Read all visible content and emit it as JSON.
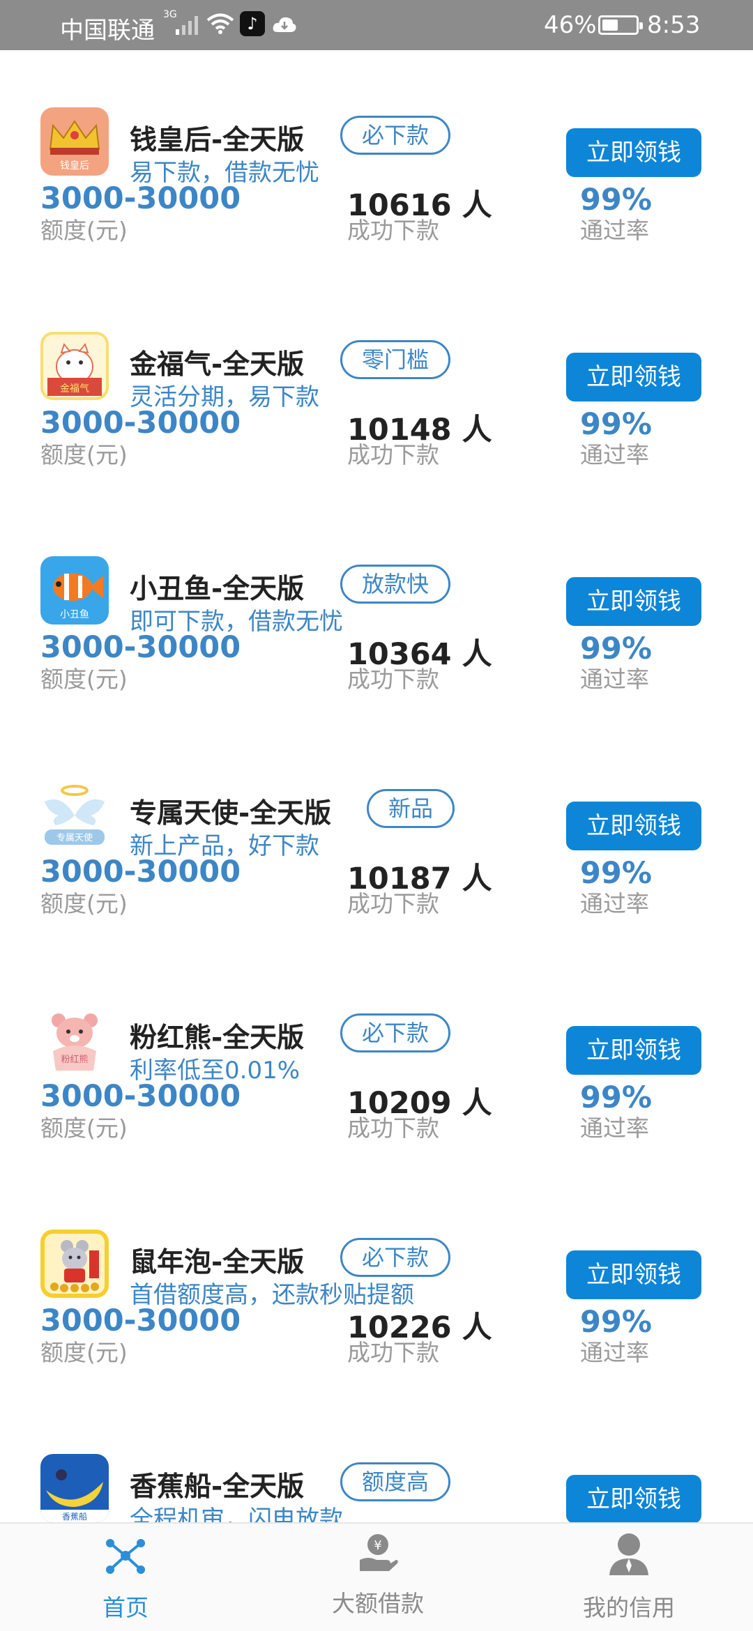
{
  "status_bar": {
    "carrier": "中国联通",
    "network": "3G",
    "tiktok_glyph": "♪",
    "battery": "46%",
    "battery_level": 0.46,
    "time": "8:53"
  },
  "products": [
    {
      "name": "钱皇后-全天版",
      "tag": "必下款",
      "slogan": "易下款，借款无忧",
      "logo_text": "钱皇后",
      "logo_icon": "crown-icon",
      "amount": "3000-30000",
      "amount_label": "额度(元)",
      "count": "10616 人",
      "count_label": "成功下款",
      "rate": "99%",
      "rate_label": "通过率",
      "cta": "立即领钱"
    },
    {
      "name": "金福气-全天版",
      "tag": "零门槛",
      "slogan": "灵活分期，易下款",
      "logo_text": "金福气",
      "logo_icon": "lucky-cat-icon",
      "amount": "3000-30000",
      "amount_label": "额度(元)",
      "count": "10148 人",
      "count_label": "成功下款",
      "rate": "99%",
      "rate_label": "通过率",
      "cta": "立即领钱"
    },
    {
      "name": "小丑鱼-全天版",
      "tag": "放款快",
      "slogan": "即可下款，借款无忧",
      "logo_text": "小丑鱼",
      "logo_icon": "clownfish-icon",
      "amount": "3000-30000",
      "amount_label": "额度(元)",
      "count": "10364 人",
      "count_label": "成功下款",
      "rate": "99%",
      "rate_label": "通过率",
      "cta": "立即领钱"
    },
    {
      "name": "专属天使-全天版",
      "tag": "新品",
      "slogan": "新上产品，好下款",
      "logo_text": "专属天使",
      "logo_icon": "angel-wings-icon",
      "amount": "3000-30000",
      "amount_label": "额度(元)",
      "count": "10187 人",
      "count_label": "成功下款",
      "rate": "99%",
      "rate_label": "通过率",
      "cta": "立即领钱"
    },
    {
      "name": "粉红熊-全天版",
      "tag": "必下款",
      "slogan": "利率低至0.01%",
      "logo_text": "粉红熊",
      "logo_icon": "pink-bear-icon",
      "amount": "3000-30000",
      "amount_label": "额度(元)",
      "count": "10209 人",
      "count_label": "成功下款",
      "rate": "99%",
      "rate_label": "通过率",
      "cta": "立即领钱"
    },
    {
      "name": "鼠年泡-全天版",
      "tag": "必下款",
      "slogan": "首借额度高，还款秒贴提额",
      "logo_text": "",
      "logo_icon": "mouse-coins-icon",
      "amount": "3000-30000",
      "amount_label": "额度(元)",
      "count": "10226 人",
      "count_label": "成功下款",
      "rate": "99%",
      "rate_label": "通过率",
      "cta": "立即领钱"
    },
    {
      "name": "香蕉船-全天版",
      "tag": "额度高",
      "slogan": "全程机审，闪电放款",
      "logo_text": "香蕉船",
      "logo_icon": "banana-boat-icon",
      "amount": "",
      "amount_label": "",
      "count": "",
      "count_label": "",
      "rate": "",
      "rate_label": "",
      "cta": "立即领钱"
    }
  ],
  "bottom_nav": {
    "items": [
      {
        "label": "首页",
        "icon": "molecule-icon",
        "active": true
      },
      {
        "label": "大额借款",
        "icon": "hand-yuan-icon",
        "active": false
      },
      {
        "label": "我的信用",
        "icon": "person-icon",
        "active": false
      }
    ]
  },
  "colors": {
    "accent": "#3d86c6",
    "button": "#0d86d8",
    "status_bar": "#8c8c8c",
    "nav_active": "#2a8fd8"
  }
}
